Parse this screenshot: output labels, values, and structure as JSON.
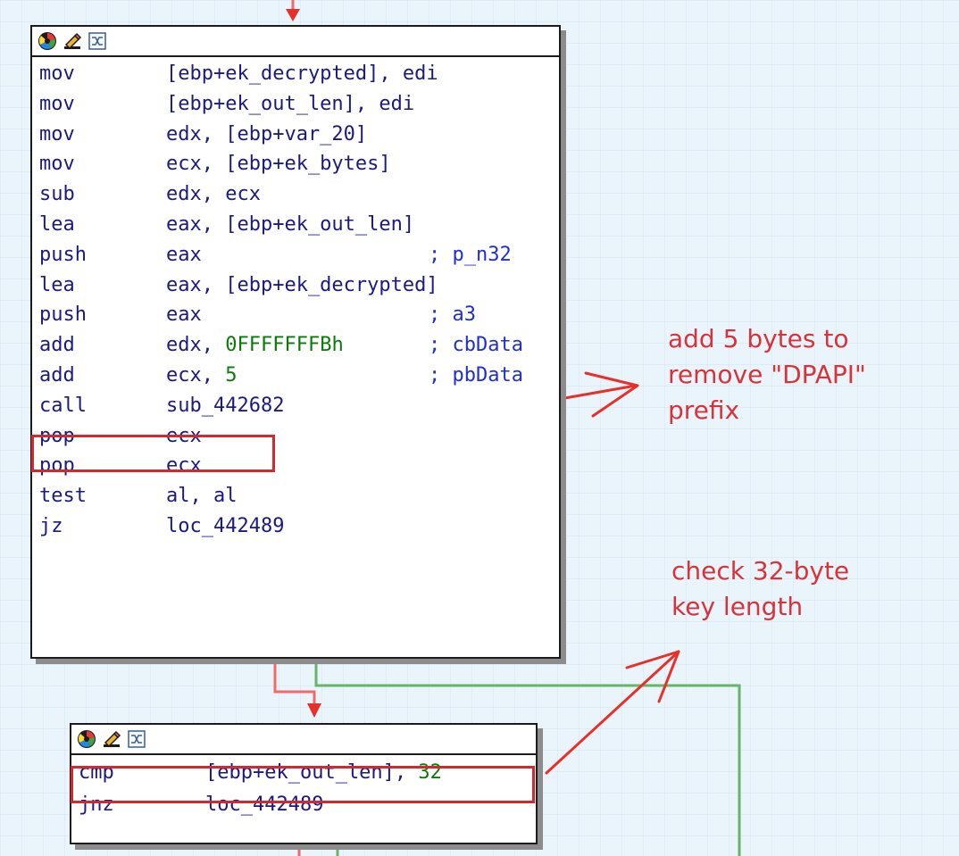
{
  "colors": {
    "background": "#eaf4fb",
    "instruction_text": "#1a1a80",
    "comment_text": "#1f2fd0",
    "number_text": "#0a7a0a",
    "annotation_red": "#d8333b",
    "edge_false_red": "#ef6b6b",
    "edge_true_green": "#66b56a",
    "edge_arrow_red": "#e8302a"
  },
  "icons": [
    "color-wheel-icon",
    "pencil-icon",
    "graph-overview-icon"
  ],
  "block1": {
    "rows": [
      {
        "mnemonic": "mov",
        "operand": "[ebp+ek_decrypted], edi",
        "comment": ""
      },
      {
        "mnemonic": "mov",
        "operand": "[ebp+ek_out_len], edi",
        "comment": ""
      },
      {
        "mnemonic": "mov",
        "operand": "edx, [ebp+var_20]",
        "comment": ""
      },
      {
        "mnemonic": "mov",
        "operand": "ecx, [ebp+ek_bytes]",
        "comment": ""
      },
      {
        "mnemonic": "sub",
        "operand": "edx, ecx",
        "comment": ""
      },
      {
        "mnemonic": "lea",
        "operand": "eax, [ebp+ek_out_len]",
        "comment": ""
      },
      {
        "mnemonic": "push",
        "operand": "eax",
        "comment": "; p_n32"
      },
      {
        "mnemonic": "lea",
        "operand": "eax, [ebp+ek_decrypted]",
        "comment": ""
      },
      {
        "mnemonic": "push",
        "operand": "eax",
        "comment": "; a3"
      },
      {
        "mnemonic": "add",
        "operand_prefix": "edx, ",
        "operand_number": "0FFFFFFFBh",
        "comment": "; cbData"
      },
      {
        "mnemonic": "add",
        "operand_prefix": "ecx, ",
        "operand_number": "5",
        "comment": "; pbData"
      },
      {
        "mnemonic": "call",
        "operand": "sub_442682",
        "comment": ""
      },
      {
        "mnemonic": "pop",
        "operand": "ecx",
        "comment": ""
      },
      {
        "mnemonic": "pop",
        "operand": "ecx",
        "comment": ""
      },
      {
        "mnemonic": "test",
        "operand": "al, al",
        "comment": ""
      },
      {
        "mnemonic": "jz",
        "operand": "loc_442489",
        "comment": ""
      }
    ]
  },
  "block2": {
    "rows": [
      {
        "mnemonic": "cmp",
        "operand_prefix": "[ebp+ek_out_len], ",
        "operand_number": "32"
      },
      {
        "mnemonic": "jnz",
        "operand": "loc_442489"
      }
    ]
  },
  "annotations": {
    "note1": "add 5 bytes to\nremove \"DPAPI\"\nprefix",
    "note2": "check 32-byte\nkey length"
  }
}
